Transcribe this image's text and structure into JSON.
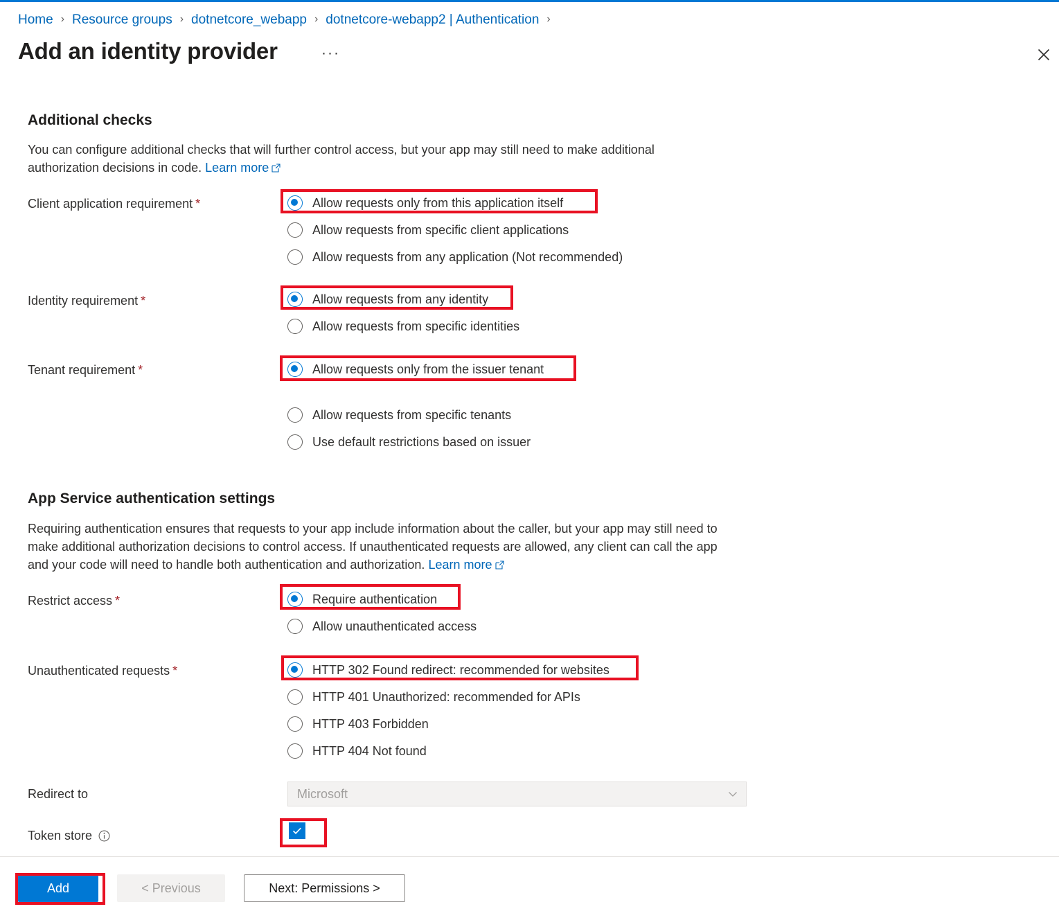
{
  "theme": {
    "accent": "#0078d4",
    "link": "#0067b8",
    "highlight": "#e81123",
    "required_star": "#a4262c",
    "text": "#323130"
  },
  "breadcrumb": {
    "items": [
      {
        "label": "Home"
      },
      {
        "label": "Resource groups"
      },
      {
        "label": "dotnetcore_webapp"
      },
      {
        "label": "dotnetcore-webapp2 | Authentication"
      }
    ],
    "separator": "›"
  },
  "header": {
    "title": "Add an identity provider",
    "ellipsis": "···",
    "close_icon": "close-icon"
  },
  "additional_checks": {
    "heading": "Additional checks",
    "description": "You can configure additional checks that will further control access, but your app may still need to make additional authorization decisions in code.",
    "learn_more": "Learn more",
    "client_application": {
      "label": "Client application requirement",
      "required": "*",
      "options": [
        {
          "label": "Allow requests only from this application itself",
          "checked": true,
          "highlighted": true
        },
        {
          "label": "Allow requests from specific client applications",
          "checked": false,
          "highlighted": false
        },
        {
          "label": "Allow requests from any application (Not recommended)",
          "checked": false,
          "highlighted": false
        }
      ]
    },
    "identity": {
      "label": "Identity requirement",
      "required": "*",
      "options": [
        {
          "label": "Allow requests from any identity",
          "checked": true,
          "highlighted": true
        },
        {
          "label": "Allow requests from specific identities",
          "checked": false,
          "highlighted": false
        }
      ]
    },
    "tenant": {
      "label": "Tenant requirement",
      "required": "*",
      "options": [
        {
          "label": "Allow requests only from the issuer tenant",
          "checked": true,
          "highlighted": true
        },
        {
          "label": "Allow requests from specific tenants",
          "checked": false,
          "highlighted": false
        },
        {
          "label": "Use default restrictions based on issuer",
          "checked": false,
          "highlighted": false
        }
      ]
    }
  },
  "app_service_auth": {
    "heading": "App Service authentication settings",
    "description": "Requiring authentication ensures that requests to your app include information about the caller, but your app may still need to make additional authorization decisions to control access. If unauthenticated requests are allowed, any client can call the app and your code will need to handle both authentication and authorization.",
    "learn_more": "Learn more",
    "restrict_access": {
      "label": "Restrict access",
      "required": "*",
      "options": [
        {
          "label": "Require authentication",
          "checked": true,
          "highlighted": true
        },
        {
          "label": "Allow unauthenticated access",
          "checked": false,
          "highlighted": false
        }
      ]
    },
    "unauthenticated_requests": {
      "label": "Unauthenticated requests",
      "required": "*",
      "options": [
        {
          "label": "HTTP 302 Found redirect: recommended for websites",
          "checked": true,
          "highlighted": true
        },
        {
          "label": "HTTP 401 Unauthorized: recommended for APIs",
          "checked": false,
          "highlighted": false
        },
        {
          "label": "HTTP 403 Forbidden",
          "checked": false,
          "highlighted": false
        },
        {
          "label": "HTTP 404 Not found",
          "checked": false,
          "highlighted": false
        }
      ]
    },
    "redirect_to": {
      "label": "Redirect to",
      "value": "Microsoft",
      "disabled": true,
      "chevron_icon": "chevron-down-icon"
    },
    "token_store": {
      "label": "Token store",
      "info_icon": "info-icon",
      "checked": true,
      "highlighted": true
    }
  },
  "footer": {
    "add_label": "Add",
    "previous_label": "< Previous",
    "next_label": "Next: Permissions >"
  }
}
